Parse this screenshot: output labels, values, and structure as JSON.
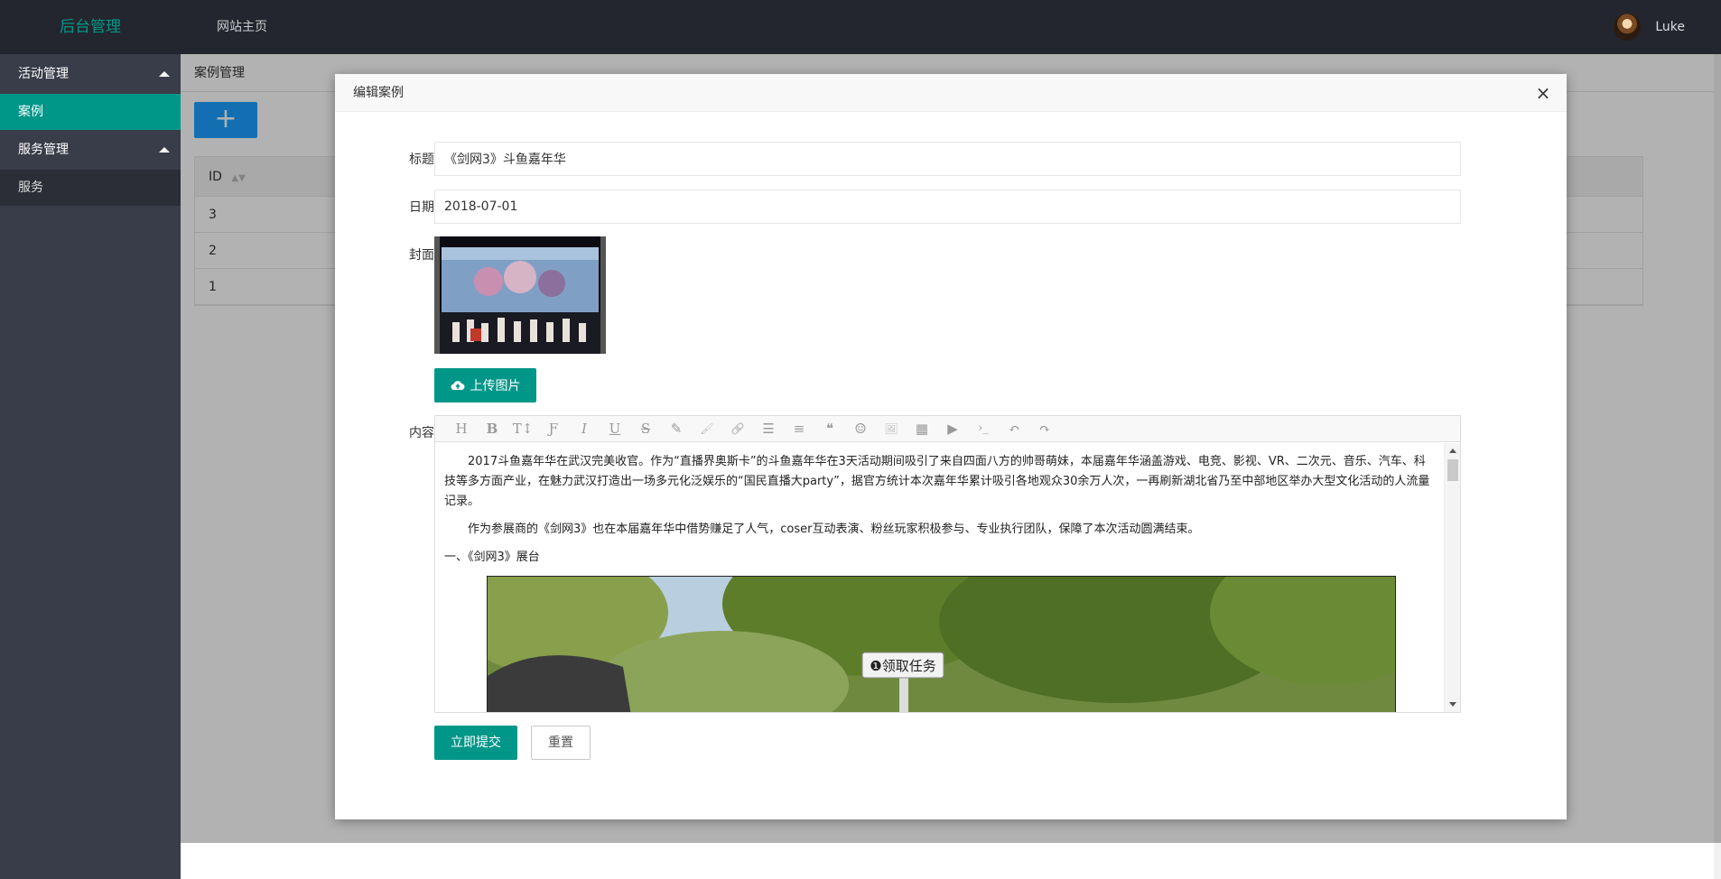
{
  "header": {
    "logo": "后台管理",
    "nav_home": "网站主页",
    "username": "Luke"
  },
  "sidebar": {
    "groups": [
      {
        "label": "活动管理",
        "items": [
          {
            "label": "案例",
            "active": true
          }
        ]
      },
      {
        "label": "服务管理",
        "items": [
          {
            "label": "服务",
            "active": false
          }
        ]
      }
    ]
  },
  "main": {
    "breadcrumb": "案例管理",
    "add_button": "+",
    "table": {
      "header_id": "ID",
      "rows": [
        "3",
        "2",
        "1"
      ]
    }
  },
  "modal": {
    "title": "编辑案例",
    "close": "×",
    "fields": {
      "title_label": "标题",
      "title_value": "《剑网3》斗鱼嘉年华",
      "date_label": "日期",
      "date_value": "2018-07-01",
      "cover_label": "封面",
      "content_label": "内容"
    },
    "upload_button": "上传图片",
    "editor": {
      "toolbar": [
        "H",
        "B",
        "T↕",
        "Ƒ",
        "I",
        "U",
        "S",
        "✎",
        "🖌",
        "🔗",
        "☰",
        "≡",
        "❝",
        "☺",
        "🖼",
        "▦",
        "▶",
        "›_",
        "↶",
        "↷"
      ],
      "paragraphs": [
        "2017斗鱼嘉年华在武汉完美收官。作为“直播界奥斯卡”的斗鱼嘉年华在3天活动期间吸引了来自四面八方的帅哥萌妹，本届嘉年华涵盖游戏、电竞、影视、VR、二次元、音乐、汽车、科技等多方面产业，在魅力武汉打造出一场多元化泛娱乐的“国民直播大party”，据官方统计本次嘉年华累计吸引各地观众30余万人次，一再刷新湖北省乃至中部地区举办大型文化活动的人流量记录。",
        "作为参展商的《剑网3》也在本届嘉年华中借势赚足了人气，coser互动表演、粉丝玩家积极参与、专业执行团队，保障了本次活动圆满结束。",
        "一、《剑网3》展台"
      ],
      "photo_sign": "❶领取任务"
    },
    "submit_button": "立即提交",
    "reset_button": "重置"
  }
}
